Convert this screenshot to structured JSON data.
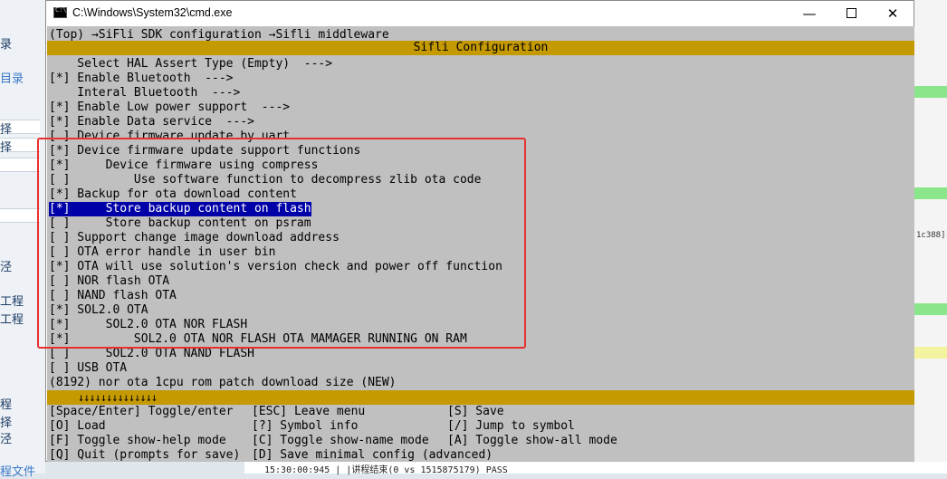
{
  "window": {
    "title": "C:\\Windows\\System32\\cmd.exe"
  },
  "menuconfig": {
    "breadcrumb": "(Top) →SiFli SDK configuration →Sifli middleware",
    "header": "Sifli Configuration",
    "items": [
      {
        "text": "    Select HAL Assert Type (Empty)  --->",
        "selected": false
      },
      {
        "text": "[*] Enable Bluetooth  --->",
        "selected": false
      },
      {
        "text": "    Interal Bluetooth  --->",
        "selected": false
      },
      {
        "text": "[*] Enable Low power support  --->",
        "selected": false
      },
      {
        "text": "[*] Enable Data service  --->",
        "selected": false
      },
      {
        "text": "[ ] Device firmware update by uart",
        "selected": false
      },
      {
        "text": "[*] Device firmware update support functions",
        "selected": false
      },
      {
        "text": "[*]     Device firmware using compress",
        "selected": false
      },
      {
        "text": "[ ]         Use software function to decompress zlib ota code",
        "selected": false
      },
      {
        "text": "[*] Backup for ota download content",
        "selected": false
      },
      {
        "text": "[*]     Store backup content on flash",
        "selected": true
      },
      {
        "text": "[ ]     Store backup content on psram",
        "selected": false
      },
      {
        "text": "[ ] Support change image download address",
        "selected": false
      },
      {
        "text": "[ ] OTA error handle in user bin",
        "selected": false
      },
      {
        "text": "[*] OTA will use solution's version check and power off function",
        "selected": false
      },
      {
        "text": "[ ] NOR flash OTA",
        "selected": false
      },
      {
        "text": "[ ] NAND flash OTA",
        "selected": false
      },
      {
        "text": "[*] SOL2.0 OTA",
        "selected": false
      },
      {
        "text": "[*]     SOL2.0 OTA NOR FLASH",
        "selected": false
      },
      {
        "text": "[*]         SOL2.0 OTA NOR FLASH OTA MAMAGER RUNNING ON RAM",
        "selected": false
      },
      {
        "text": "[ ]     SOL2.0 OTA NAND FLASH",
        "selected": false
      },
      {
        "text": "[ ] USB OTA",
        "selected": false
      },
      {
        "text": "(8192) nor ota 1cpu rom patch download size (NEW)",
        "selected": false
      }
    ],
    "scroll_indicator": "↓↓↓↓↓↓↓↓↓↓↓↓↓↓",
    "help": [
      {
        "col": 0,
        "row": 0,
        "text": "[Space/Enter] Toggle/enter"
      },
      {
        "col": 1,
        "row": 0,
        "text": "[ESC] Leave menu"
      },
      {
        "col": 2,
        "row": 0,
        "text": "[S] Save"
      },
      {
        "col": 0,
        "row": 1,
        "text": "[O] Load"
      },
      {
        "col": 1,
        "row": 1,
        "text": "[?] Symbol info"
      },
      {
        "col": 2,
        "row": 1,
        "text": "[/] Jump to symbol"
      },
      {
        "col": 0,
        "row": 2,
        "text": "[F] Toggle show-help mode"
      },
      {
        "col": 1,
        "row": 2,
        "text": "[C] Toggle show-name mode"
      },
      {
        "col": 2,
        "row": 2,
        "text": "[A] Toggle show-all mode"
      },
      {
        "col": 0,
        "row": 3,
        "text": "[Q] Quit (prompts for save)"
      },
      {
        "col": 1,
        "row": 3,
        "text": "[D] Save minimal config (advanced)"
      }
    ]
  },
  "background": {
    "left_labels": [
      "录",
      "目录",
      "择",
      "择",
      "泾",
      "工程",
      "工程",
      "程",
      "择",
      "泾",
      "程文件"
    ],
    "right_text": "1c388]",
    "bottom_status": "15:30:00:945  | |讲程结束(0 vs 1515875179) PASS"
  },
  "colors": {
    "console_bg": "#c0c0c0",
    "band": "#c49a00",
    "selection": "#0000a8",
    "annotation": "#e83030"
  }
}
